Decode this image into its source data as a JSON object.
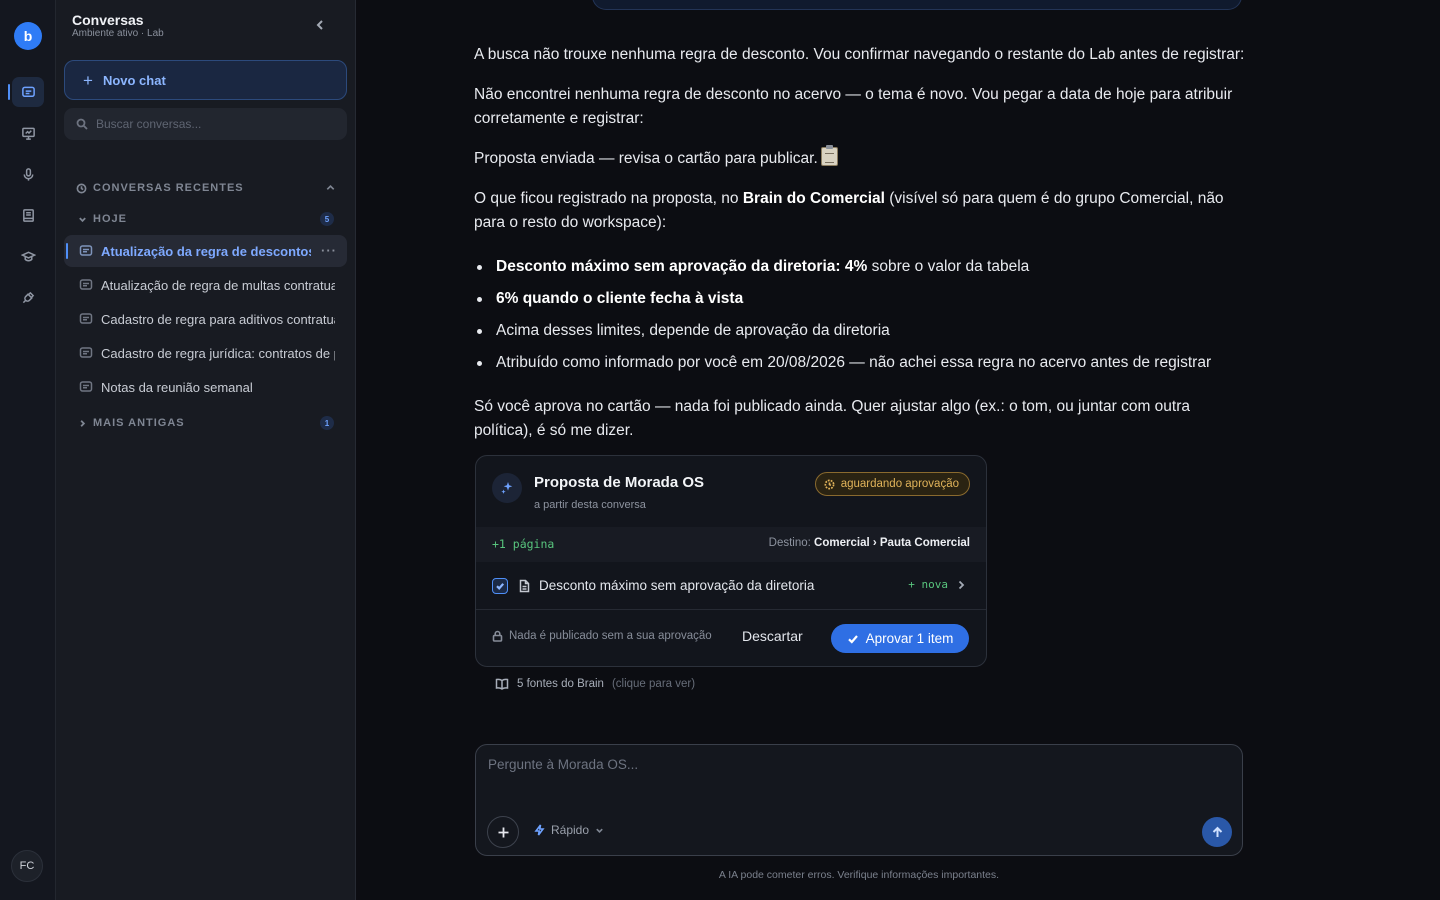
{
  "rail": {
    "logo_glyph": "b",
    "items": [
      "chat-icon",
      "presentation-icon",
      "microphone-icon",
      "book-icon",
      "graduation-cap-icon",
      "plug-icon"
    ],
    "active_index": 0,
    "avatar_initials": "FC"
  },
  "sidebar": {
    "title": "Conversas",
    "subtitle": "Ambiente ativo · Lab",
    "new_chat_label": "Novo chat",
    "search_placeholder": "Buscar conversas...",
    "section_label": "CONVERSAS RECENTES",
    "groups": {
      "today": {
        "label": "HOJE",
        "count": "5"
      },
      "older": {
        "label": "MAIS ANTIGAS",
        "count": "1"
      }
    },
    "conversations": [
      "Atualização da regra de descontos no comercial",
      "Atualização de regra de multas contratuais",
      "Cadastro de regra para aditivos contratuais",
      "Cadastro de regra jurídica: contratos de prestação",
      "Notas da reunião semanal"
    ],
    "active_conversation_index": 0,
    "more_glyph": "···"
  },
  "chat": {
    "messages": {
      "m1": "A busca não trouxe nenhuma regra de desconto. Vou confirmar navegando o restante do Lab antes de registrar:",
      "m2": "Não encontrei nenhuma regra de desconto no acervo — o tema é novo. Vou pegar a data de hoje para atribuir corretamente e registrar:",
      "m3": "Proposta enviada — revisa o cartão para publicar.",
      "m4_before": "O que ficou registrado na proposta, no ",
      "m4_bold": "Brain do Comercial",
      "m4_after": " (visível só para quem é do grupo Comercial, não para o resto do workspace):",
      "m5": "Só você aprova no cartão — nada foi publicado ainda. Quer ajustar algo (ex.: o tom, ou juntar com outra política), é só me dizer."
    },
    "bullets": {
      "b1_bold": "Desconto máximo sem aprovação da diretoria: 4%",
      "b1_rest": " sobre o valor da tabela",
      "b2_bold": "6% quando o cliente fecha à vista",
      "b3": "Acima desses limites, depende de aprovação da diretoria",
      "b4": "Atribuído como informado por você em 20/08/2026 — não achei essa regra no acervo antes de registrar"
    }
  },
  "proposal_card": {
    "title": "Proposta de Morada OS",
    "subtitle": "a partir desta conversa",
    "status": "aguardando aprovação",
    "pages": "+1 página",
    "destination_label": "Destino: ",
    "destination_value": "Comercial › Pauta Comercial",
    "item_label": "Desconto máximo sem aprovação da diretoria",
    "item_tag": "+ nova",
    "lock_note": "Nada é publicado sem a sua aprovação",
    "discard_label": "Descartar",
    "approve_label": "Aprovar 1 item"
  },
  "sources": {
    "label": "5 fontes do Brain",
    "hint": "(clique para ver)"
  },
  "composer": {
    "placeholder": "Pergunte à Morada OS...",
    "mode_label": "Rápido"
  },
  "disclaimer": "A IA pode cometer erros. Verifique informações importantes.",
  "colors": {
    "accent": "#2f7cf6",
    "approve_button": "#2f6fe4",
    "pending_badge": "#e0b35a",
    "new_tag": "#58c47d"
  }
}
